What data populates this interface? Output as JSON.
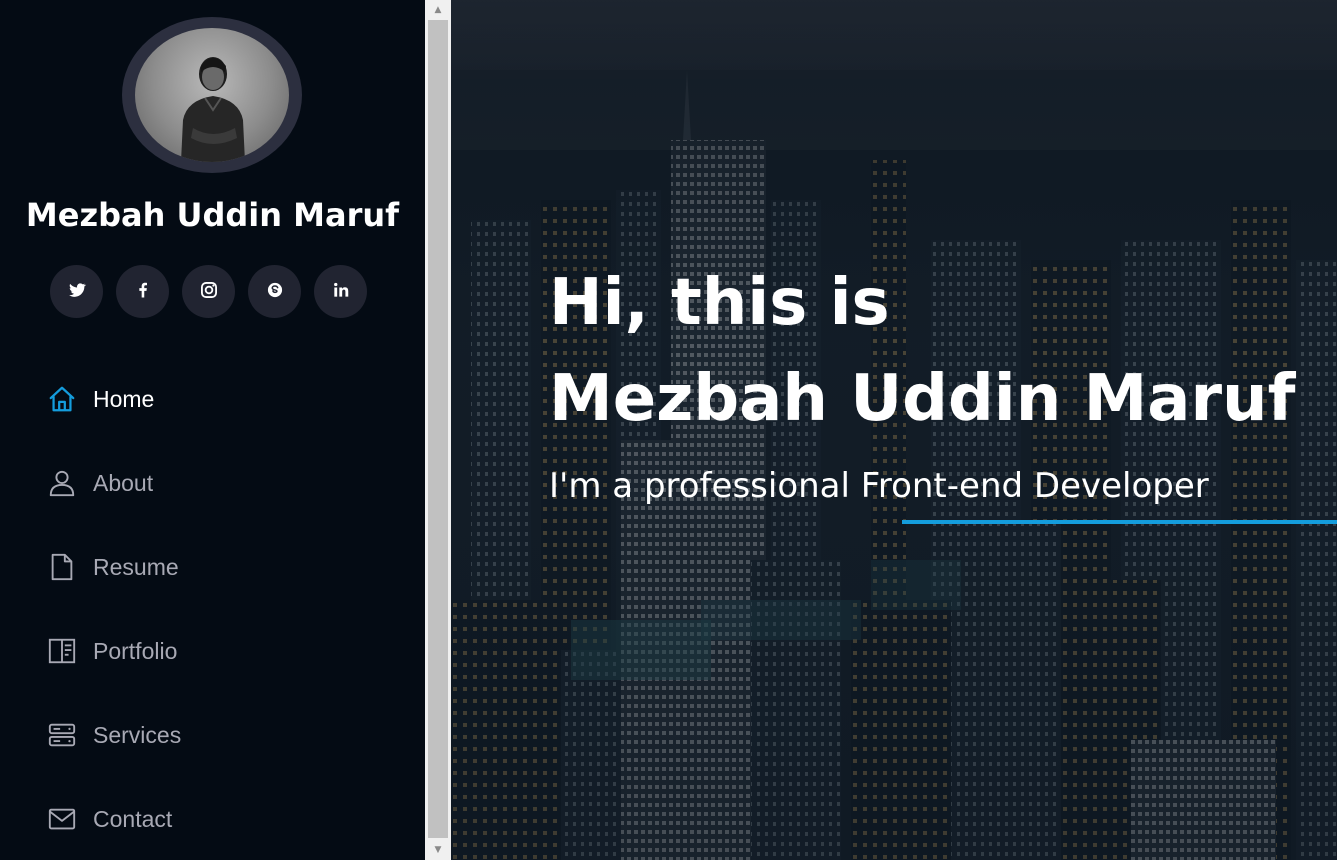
{
  "profile": {
    "name": "Mezbah Uddin Maruf"
  },
  "socials": [
    {
      "icon": "twitter-icon"
    },
    {
      "icon": "facebook-icon"
    },
    {
      "icon": "instagram-icon"
    },
    {
      "icon": "skype-icon"
    },
    {
      "icon": "linkedin-icon"
    }
  ],
  "nav": {
    "items": [
      {
        "label": "Home",
        "icon": "home-icon",
        "active": true
      },
      {
        "label": "About",
        "icon": "person-icon",
        "active": false
      },
      {
        "label": "Resume",
        "icon": "file-icon",
        "active": false
      },
      {
        "label": "Portfolio",
        "icon": "book-icon",
        "active": false
      },
      {
        "label": "Services",
        "icon": "server-icon",
        "active": false
      },
      {
        "label": "Contact",
        "icon": "envelope-icon",
        "active": false
      }
    ]
  },
  "hero": {
    "line1": "Hi, this is",
    "line2": "Mezbah Uddin Maruf",
    "subtitle": "I'm a professional Front-end Developer"
  },
  "colors": {
    "accent": "#149ddd",
    "sidebar_bg": "#040b14",
    "social_bg": "#212431",
    "nav_text": "#a8a9b4"
  }
}
